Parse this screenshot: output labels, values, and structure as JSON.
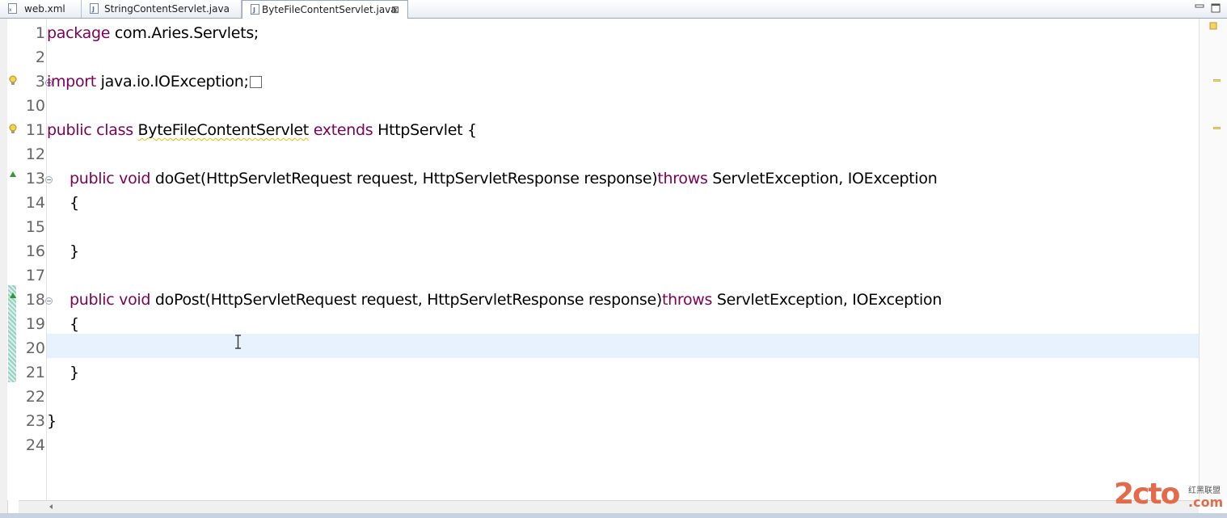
{
  "tabs": [
    {
      "label": "web.xml",
      "icon": "xml-file-icon",
      "active": false
    },
    {
      "label": "StringContentServlet.java",
      "icon": "java-file-icon",
      "active": false
    },
    {
      "label": "ByteFileContentServlet.java",
      "icon": "java-file-icon",
      "active": true,
      "close": "⊠"
    }
  ],
  "editor": {
    "lines": [
      {
        "num": "1"
      },
      {
        "num": "2"
      },
      {
        "num": "3"
      },
      {
        "num": "10"
      },
      {
        "num": "11"
      },
      {
        "num": "12"
      },
      {
        "num": "13"
      },
      {
        "num": "14"
      },
      {
        "num": "15"
      },
      {
        "num": "16"
      },
      {
        "num": "17"
      },
      {
        "num": "18"
      },
      {
        "num": "19"
      },
      {
        "num": "20"
      },
      {
        "num": "21"
      },
      {
        "num": "22"
      },
      {
        "num": "23"
      },
      {
        "num": "24"
      }
    ],
    "code": {
      "l1_kw": "package",
      "l1_rest": " com.Aries.Servlets;",
      "l3_kw": "import",
      "l3_rest": " java.io.IOException;",
      "l11_kw1": "public",
      "l11_sp1": " ",
      "l11_kw2": "class",
      "l11_sp2": " ",
      "l11_name": "ByteFileContentServlet",
      "l11_sp3": " ",
      "l11_kw3": "extends",
      "l11_rest": " HttpServlet {",
      "l13_kw1": "public",
      "l13_sp1": " ",
      "l13_kw2": "void",
      "l13_mid": " doGet(HttpServletRequest request, HttpServletResponse response)",
      "l13_kw3": "throws",
      "l13_rest": " ServletException, IOException",
      "l14": "{",
      "l16": "}",
      "l18_kw1": "public",
      "l18_sp1": " ",
      "l18_kw2": "void",
      "l18_mid": " doPost(HttpServletRequest request, HttpServletResponse response)",
      "l18_kw3": "throws",
      "l18_rest": " ServletException, IOException",
      "l19": "{",
      "l21": "}",
      "l23": "}"
    },
    "current_line": "20"
  },
  "colors": {
    "keyword": "#7f0055",
    "current_line": "#e8f2fe",
    "warning_marker": "#f2d88a"
  },
  "watermark": {
    "main": "2cto",
    "sub": "红黑联盟",
    "domain": ".com"
  }
}
